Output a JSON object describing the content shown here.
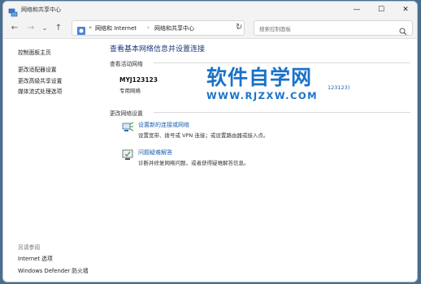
{
  "window": {
    "title": "网络和共享中心",
    "minimize_glyph": "—",
    "maximize_glyph": "☐",
    "close_glyph": "✕"
  },
  "nav": {
    "back_glyph": "←",
    "forward_glyph": "→",
    "dropdown_glyph": "⌄",
    "up_glyph": "↑",
    "refresh_glyph": "↻"
  },
  "address": {
    "separator": "«",
    "segment1": "网络和 Internet",
    "arrow": "›",
    "segment2": "网络和共享中心",
    "dropdown_glyph": "⌄"
  },
  "search": {
    "placeholder": "搜索控制面板"
  },
  "sidebar": {
    "items": [
      {
        "label": "控制面板主页"
      },
      {
        "label": "更改适配器设置"
      },
      {
        "label": "更改高级共享设置"
      },
      {
        "label": "媒体流式处理选项"
      }
    ],
    "see_also": "另请参阅",
    "see_also_items": [
      {
        "label": "Internet 选项"
      },
      {
        "label": "Windows Defender 防火墙"
      }
    ]
  },
  "main": {
    "title": "查看基本网络信息并设置连接",
    "active_networks_header": "查看活动网络",
    "network": {
      "name": "MYJ123123",
      "type": "专用网络",
      "connection_link_partial": "123123)"
    },
    "change_settings_header": "更改网络设置",
    "tasks": [
      {
        "link": "设置新的连接或网络",
        "desc": "设置宽带、拨号或 VPN 连接；或设置路由器或接入点。"
      },
      {
        "link": "问题疑难解答",
        "desc": "诊断并修复网络问题，或者获得疑难解答信息。"
      }
    ]
  },
  "watermark": {
    "main": "软件自学网",
    "url": "WWW.RJZXW.COM"
  },
  "colors": {
    "link": "#1a5fb4",
    "title": "#1a3a7a",
    "watermark": "#1a72c8"
  }
}
